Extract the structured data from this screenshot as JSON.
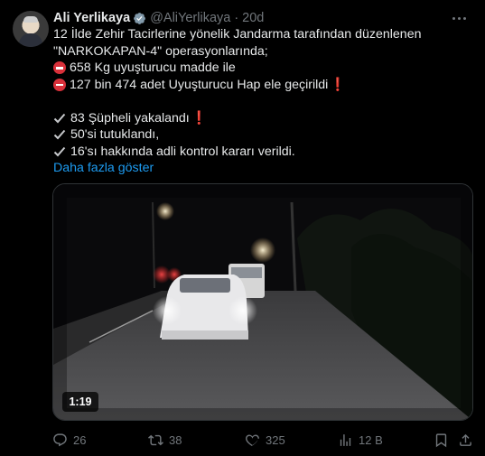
{
  "author": {
    "name": "Ali Yerlikaya",
    "handle": "@AliYerlikaya",
    "separator": "·",
    "time": "20d"
  },
  "body": {
    "line1": "12 İlde Zehir Tacirlerine yönelik Jandarma tarafından düzenlenen",
    "line2": "\"NARKOKAPAN-4\" operasyonlarında;",
    "line3": "658 Kg uyuşturucu madde ile",
    "line4": "127 bin 474 adet Uyuşturucu Hap ele geçirildi",
    "line5": "83 Şüpheli yakalandı",
    "line6": "50'si tutuklandı,",
    "line7": "16'sı hakkında adli kontrol kararı verildi.",
    "show_more": "Daha fazla göster",
    "exclamation": "❗"
  },
  "media": {
    "duration": "1:19"
  },
  "actions": {
    "replies": "26",
    "reposts": "38",
    "likes": "325",
    "views": "12 B"
  },
  "colors": {
    "accent": "#1d9bf0",
    "text": "#e7e9ea",
    "muted": "#71767b",
    "alert": "#d9303a",
    "background": "#000000"
  }
}
